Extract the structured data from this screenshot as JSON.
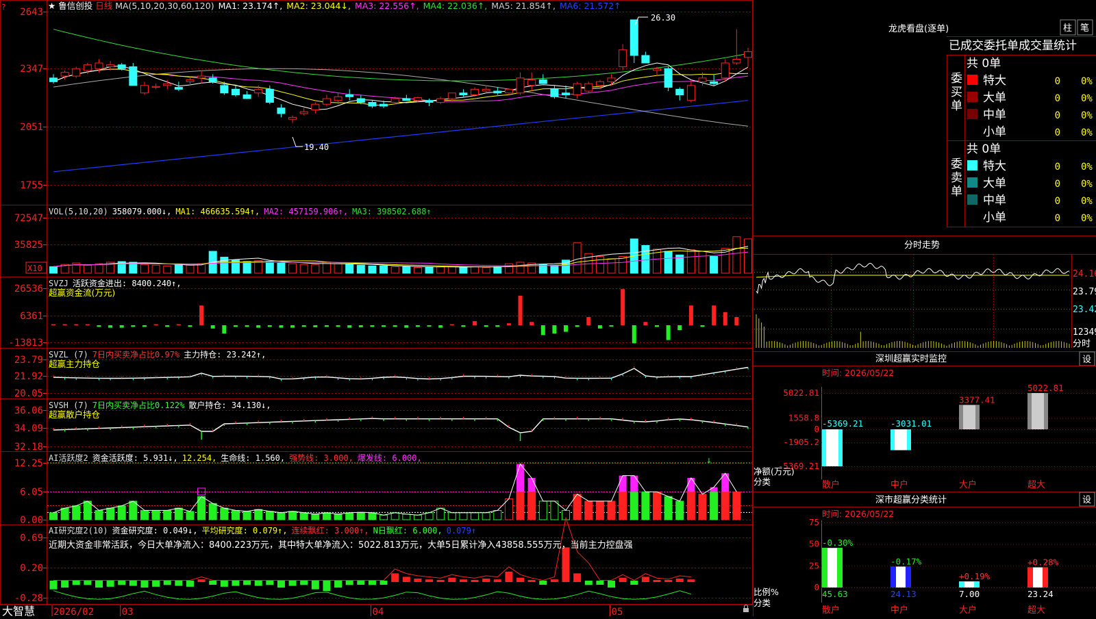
{
  "app": {
    "stock_name": "鲁信创投",
    "period": "日线",
    "brand": "大智慧",
    "star": "★"
  },
  "colors": {
    "up": "#ff2020",
    "down": "#33ffff",
    "grid": "#a00000",
    "ma1": "#ffffff",
    "ma2": "#ffff00",
    "ma3": "#ff33ff",
    "ma4": "#33dd33",
    "ma5": "#aaaaaa",
    "ma6": "#1e3cff",
    "green": "#22ee22",
    "magenta": "#ff22ff"
  },
  "main_chart": {
    "legend": [
      {
        "text": "MA(5,10,20,30,60,120)",
        "color": "#dddddd"
      },
      {
        "text": "MA1: 23.174↑,",
        "color": "#ffffff"
      },
      {
        "text": "MA2: 23.044↓,",
        "color": "#ffff00"
      },
      {
        "text": "MA3: 22.556↑,",
        "color": "#ff33ff"
      },
      {
        "text": "MA4: 22.036↑,",
        "color": "#33dd33"
      },
      {
        "text": "MA5: 21.854↑,",
        "color": "#cccccc"
      },
      {
        "text": "MA6: 21.572↑",
        "color": "#2244ff"
      }
    ],
    "y_ticks": [
      "2643",
      "2347",
      "2051",
      "1755"
    ],
    "high_label": "26.30",
    "low_label": "19.40"
  },
  "vol_chart": {
    "legend": [
      {
        "text": "VOL(5,10,20)",
        "color": "#dddddd"
      },
      {
        "text": "358079.000↓,",
        "color": "#ffffff"
      },
      {
        "text": "MA1: 466635.594↑,",
        "color": "#ffff00"
      },
      {
        "text": "MA2: 457159.906↑,",
        "color": "#ff33ff"
      },
      {
        "text": "MA3: 398502.688↑",
        "color": "#33dd33"
      }
    ],
    "y_ticks": [
      "72547",
      "35825"
    ],
    "unit_badge": "X10"
  },
  "svzj": {
    "legend": [
      {
        "text": "SVZJ",
        "color": "#dddddd"
      },
      {
        "text": "活跃资金进出: 8400.240↑,",
        "color": "#ffffff"
      }
    ],
    "title2": "超赢资金流(万元)",
    "y_ticks": [
      "26536",
      "6361",
      "-13813"
    ]
  },
  "svzl": {
    "legend": [
      {
        "text": "SVZL (7)",
        "color": "#dddddd"
      },
      {
        "text": "7日内买卖净占比0.97%",
        "color": "#ff3333"
      },
      {
        "text": "主力持仓: 23.242↑,",
        "color": "#ffffff"
      }
    ],
    "title2": "超赢主力持仓",
    "y_ticks": [
      "23.79",
      "21.92",
      "20.05"
    ]
  },
  "svsh": {
    "legend": [
      {
        "text": "SVSH (7)",
        "color": "#dddddd"
      },
      {
        "text": "7日内买卖净占比0.122%",
        "color": "#33ff33"
      },
      {
        "text": "散户持仓: 34.130↓,",
        "color": "#ffffff"
      }
    ],
    "title2": "超赢散户持仓",
    "y_ticks": [
      "36.06",
      "34.09",
      "32.18"
    ]
  },
  "ai_active": {
    "legend": [
      {
        "text": "AI活跃度2",
        "color": "#dddddd"
      },
      {
        "text": "资金活跃度: 5.931↓,",
        "color": "#ffffff"
      },
      {
        "text": "12.254,",
        "color": "#ffff00"
      },
      {
        "text": "生命线: 1.560,",
        "color": "#ffffff"
      },
      {
        "text": "强势线: 3.000,",
        "color": "#ff3333"
      },
      {
        "text": "爆发线: 6.000,",
        "color": "#ff33ff"
      }
    ],
    "y_ticks": [
      "12.25",
      "6.05",
      "0.00"
    ]
  },
  "ai_research": {
    "legend": [
      {
        "text": "AI研究度2(10)",
        "color": "#dddddd"
      },
      {
        "text": "资金研究度: 0.049↓,",
        "color": "#ffffff"
      },
      {
        "text": "平均研究度: 0.079↑,",
        "color": "#ffff00"
      },
      {
        "text": "连续飘红: 3.000↑,",
        "color": "#ff3333"
      },
      {
        "text": "N日飘红: 6.000,",
        "color": "#33ff33"
      },
      {
        "text": "0.079↑",
        "color": "#2244ff"
      }
    ],
    "commentary": "近期大资金非常活跃，今日大单净流入：8400.223万元，其中特大单净流入：5022.813万元，大单5日累计净入43858.555万元，当前主力控盘强",
    "y_ticks": [
      "0.69",
      "0.20",
      "-0.28"
    ]
  },
  "x_axis": {
    "labels": [
      {
        "text": "2026/02",
        "pos": 0
      },
      {
        "text": "03",
        "pos": 6
      },
      {
        "text": "04",
        "pos": 28
      },
      {
        "text": "05",
        "pos": 49
      }
    ]
  },
  "dragon_tiger": {
    "title": "龙虎看盘(逐单)",
    "btn_bar": "柱",
    "btn_pen": "笔",
    "header": "已成交委托单成交量统计",
    "buy": {
      "side_label": "委买单",
      "total": "共 0单",
      "rows": [
        {
          "label": "特大",
          "count": "0",
          "pct": "0%",
          "swatch": "#ff0000"
        },
        {
          "label": "大单",
          "count": "0",
          "pct": "0%",
          "swatch": "#990000"
        },
        {
          "label": "中单",
          "count": "0",
          "pct": "0%",
          "swatch": "#770000"
        },
        {
          "label": "小单",
          "count": "0",
          "pct": "0%",
          "swatch": ""
        }
      ]
    },
    "sell": {
      "side_label": "委卖单",
      "total": "共 0单",
      "rows": [
        {
          "label": "特大",
          "count": "0",
          "pct": "0%",
          "swatch": "#33ffff"
        },
        {
          "label": "大单",
          "count": "0",
          "pct": "0%",
          "swatch": "#118888"
        },
        {
          "label": "中单",
          "count": "0",
          "pct": "0%",
          "swatch": "#116666"
        },
        {
          "label": "小单",
          "count": "0",
          "pct": "0%",
          "swatch": ""
        }
      ]
    }
  },
  "intraday": {
    "title": "分时走势",
    "y_labels": [
      "24.16",
      "23.79",
      "23.42"
    ],
    "vol_label": "12349",
    "period_label": "分时"
  },
  "realtime_monitor": {
    "title": "深圳超赢实时监控",
    "btn": "设",
    "time_label": "时间: 2026/05/22",
    "ylabel_top": "净额(万元)",
    "ylabel_bot": "分类",
    "y_ticks": [
      "5022.81",
      "1558.8",
      "0",
      "-1905.2",
      "-5369.21"
    ],
    "categories": [
      "散户",
      "中户",
      "大户",
      "超大"
    ],
    "values": [
      -5369.21,
      -3031.01,
      3377.41,
      5022.81
    ],
    "value_labels": [
      "-5369.21",
      "-3031.01",
      "3377.41",
      "5022.81"
    ]
  },
  "classification": {
    "title": "深市超赢分类统计",
    "btn": "设",
    "time_label": "时间: 2026/05/22",
    "ylabel_top": "比例%",
    "ylabel_bot": "分类",
    "y_ticks": [
      "75",
      "50",
      "25",
      "0"
    ],
    "categories": [
      "散户",
      "中户",
      "大户",
      "超大"
    ],
    "values": [
      45.63,
      24.13,
      7.0,
      23.24
    ],
    "value_labels": [
      "45.63",
      "24.13",
      "7.00",
      "23.24"
    ],
    "change_labels": [
      "-0.30%",
      "-0.17%",
      "+0.19%",
      "+0.28%"
    ],
    "bar_colors": [
      "#22ee22",
      "#2222ff",
      "#33ffff",
      "#ff2020"
    ],
    "value_colors": [
      "#22ee22",
      "#2244ff",
      "#ffffff",
      "#ffffff"
    ],
    "change_colors": [
      "#22ee22",
      "#22ee22",
      "#ff3333",
      "#ff3333"
    ]
  },
  "chart_data": {
    "type": "candlestick",
    "unit_note": "",
    "ohlc": [
      [
        23.2,
        23.4,
        22.9,
        23.0
      ],
      [
        23.3,
        23.6,
        23.1,
        23.5
      ],
      [
        23.3,
        23.8,
        23.2,
        23.7
      ],
      [
        23.6,
        24.0,
        23.4,
        23.9
      ],
      [
        23.7,
        24.2,
        23.5,
        24.0
      ],
      [
        23.8,
        24.1,
        23.6,
        23.9
      ],
      [
        23.9,
        24.0,
        23.6,
        23.7
      ],
      [
        23.8,
        24.0,
        22.8,
        22.8
      ],
      [
        22.4,
        23.0,
        22.3,
        22.8
      ],
      [
        22.7,
        22.9,
        22.6,
        22.75
      ],
      [
        22.8,
        23.1,
        22.6,
        22.9
      ],
      [
        22.7,
        23.0,
        22.5,
        22.6
      ],
      [
        23.0,
        23.3,
        22.8,
        23.1
      ],
      [
        23.2,
        23.6,
        22.9,
        23.3
      ],
      [
        23.2,
        23.4,
        22.9,
        23.0
      ],
      [
        22.8,
        23.0,
        22.3,
        22.4
      ],
      [
        22.6,
        22.8,
        22.2,
        22.3
      ],
      [
        22.3,
        22.5,
        22.1,
        22.1
      ],
      [
        22.4,
        22.8,
        22.2,
        22.6
      ],
      [
        22.6,
        22.8,
        21.8,
        21.9
      ],
      [
        21.6,
        21.8,
        21.1,
        21.3
      ],
      [
        21.0,
        21.2,
        20.8,
        21.1
      ],
      [
        21.3,
        21.6,
        21.2,
        21.4
      ],
      [
        21.5,
        21.9,
        21.3,
        21.8
      ],
      [
        21.8,
        22.3,
        21.7,
        22.1
      ],
      [
        22.0,
        22.4,
        21.8,
        22.2
      ],
      [
        22.3,
        22.6,
        22.0,
        22.2
      ],
      [
        22.1,
        22.3,
        21.8,
        21.9
      ],
      [
        21.9,
        22.0,
        21.6,
        21.7
      ],
      [
        21.8,
        22.0,
        21.6,
        21.7
      ],
      [
        21.9,
        22.2,
        21.8,
        22.1
      ],
      [
        22.1,
        22.3,
        22.0,
        22.0
      ],
      [
        22.0,
        22.2,
        21.9,
        22.15
      ],
      [
        22.0,
        22.1,
        21.7,
        21.9
      ],
      [
        21.9,
        22.2,
        21.8,
        22.1
      ],
      [
        22.1,
        22.4,
        22.0,
        22.4
      ],
      [
        22.4,
        22.6,
        22.2,
        22.3
      ],
      [
        22.3,
        22.7,
        22.2,
        22.6
      ],
      [
        22.5,
        22.8,
        22.4,
        22.6
      ],
      [
        22.5,
        22.7,
        22.3,
        22.4
      ],
      [
        22.4,
        22.6,
        22.3,
        22.6
      ],
      [
        22.4,
        23.5,
        22.3,
        23.2
      ],
      [
        22.8,
        23.5,
        22.5,
        23.1
      ],
      [
        23.1,
        23.4,
        22.9,
        22.9
      ],
      [
        22.6,
        22.8,
        22.1,
        22.2
      ],
      [
        22.4,
        22.8,
        22.1,
        22.3
      ],
      [
        22.3,
        23.0,
        22.1,
        22.9
      ],
      [
        22.5,
        23.0,
        22.4,
        22.9
      ],
      [
        22.8,
        23.1,
        22.6,
        23.0
      ],
      [
        23.0,
        23.4,
        22.8,
        23.2
      ],
      [
        23.8,
        25.0,
        23.6,
        24.7
      ],
      [
        26.3,
        26.3,
        24.0,
        24.4
      ],
      [
        24.4,
        24.6,
        24.0,
        24.0
      ],
      [
        23.6,
        23.8,
        23.3,
        23.7
      ],
      [
        23.7,
        23.8,
        22.5,
        22.7
      ],
      [
        22.6,
        22.7,
        22.0,
        22.3
      ],
      [
        22.0,
        23.1,
        21.9,
        22.8
      ],
      [
        23.0,
        23.5,
        22.8,
        23.2
      ],
      [
        23.0,
        23.4,
        22.8,
        22.9
      ],
      [
        23.2,
        24.2,
        23.0,
        24.0
      ],
      [
        24.0,
        25.8,
        23.9,
        24.2
      ],
      [
        24.3,
        24.8,
        23.8,
        24.6
      ]
    ],
    "volume_x10": [
      9000,
      12000,
      14000,
      11000,
      13000,
      15000,
      16000,
      15000,
      12000,
      11000,
      10000,
      12000,
      11000,
      13000,
      30000,
      22000,
      18000,
      16000,
      17000,
      15000,
      14000,
      13000,
      12000,
      12000,
      15000,
      13000,
      12000,
      11000,
      10000,
      10000,
      9000,
      9000,
      8000,
      8000,
      9000,
      9000,
      8000,
      9000,
      8000,
      9000,
      13000,
      15000,
      14000,
      12000,
      11000,
      18000,
      42000,
      27000,
      23000,
      20000,
      23000,
      47000,
      38000,
      33000,
      30000,
      25000,
      32000,
      30000,
      23000,
      34000,
      50000,
      47000
    ],
    "svzj_values": [
      0,
      0,
      0,
      500,
      -1000,
      -1500,
      -1500,
      -1000,
      -1000,
      0,
      -1000,
      200,
      -1000,
      12000,
      -2000,
      -5000,
      -1000,
      -1000,
      -1500,
      -1000,
      -1500,
      -1500,
      -1000,
      -1200,
      -1000,
      -1000,
      -1500,
      -1200,
      -1000,
      -1000,
      -1000,
      -1500,
      -1000,
      -800,
      -1500,
      500,
      -1000,
      2500,
      -1000,
      -1000,
      1200,
      18000,
      2000,
      -6000,
      -5000,
      -4000,
      -1000,
      5000,
      -2000,
      -800,
      22000,
      -11000,
      2000,
      -1000,
      -9000,
      -3000,
      12000,
      -1000,
      12000,
      8000,
      5000
    ],
    "ai_active_values": [
      1.5,
      2.5,
      3.0,
      4.0,
      2.0,
      2.5,
      3.0,
      4.0,
      2.0,
      2.0,
      2.0,
      2.5,
      1.8,
      5.0,
      3.5,
      2.5,
      2.0,
      1.8,
      2.2,
      1.8,
      1.5,
      1.8,
      1.5,
      1.2,
      1.5,
      1.2,
      1.5,
      1.6,
      1.5,
      1.0,
      1.5,
      1.2,
      1.0,
      1.5,
      2.5,
      1.5,
      1.5,
      1.5,
      1.5,
      2.0,
      4.5,
      12.0,
      9.0,
      4.0,
      4.0,
      2.0,
      5.5,
      4.0,
      4.0,
      4.0,
      9.5,
      9.5,
      6.0,
      6.0,
      5.0,
      4.0,
      9.0,
      5.5,
      7.0,
      10.0,
      6.0
    ],
    "ai_research_values": [
      -0.1,
      -0.08,
      -0.05,
      -0.05,
      -0.08,
      -0.07,
      -0.05,
      -0.06,
      -0.08,
      -0.07,
      -0.05,
      -0.06,
      -0.07,
      0.03,
      -0.04,
      -0.07,
      -0.06,
      -0.05,
      -0.06,
      -0.05,
      -0.08,
      -0.06,
      -0.05,
      -0.1,
      -0.12,
      -0.08,
      -0.05,
      -0.04,
      -0.05,
      -0.03,
      0.1,
      0.06,
      0.04,
      0.03,
      0.02,
      0.05,
      0.03,
      0.02,
      0.04,
      0.03,
      0.12,
      0.05,
      0.02,
      -0.01,
      0.03,
      0.4,
      0.1,
      -0.05,
      -0.02,
      -0.08,
      0.05,
      -0.04,
      0.06,
      0.02,
      0.01,
      0.04,
      0.03
    ]
  }
}
